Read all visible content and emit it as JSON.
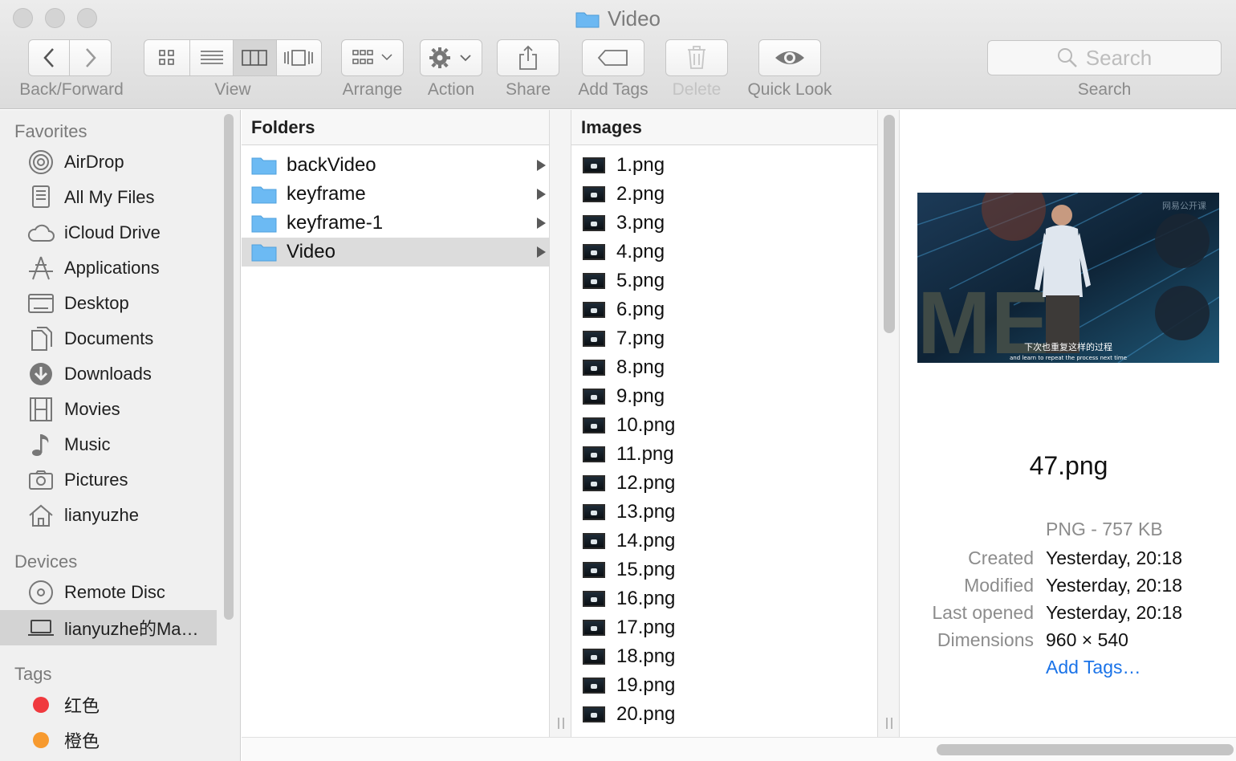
{
  "window": {
    "title": "Video"
  },
  "toolbar": {
    "back_forward_label": "Back/Forward",
    "view_label": "View",
    "arrange_label": "Arrange",
    "action_label": "Action",
    "share_label": "Share",
    "add_tags_label": "Add Tags",
    "delete_label": "Delete",
    "quick_look_label": "Quick Look",
    "search_placeholder": "Search",
    "search_label": "Search"
  },
  "sidebar": {
    "favorites_title": "Favorites",
    "favorites": [
      {
        "label": "AirDrop",
        "icon": "airdrop-icon"
      },
      {
        "label": "All My Files",
        "icon": "all-my-files-icon"
      },
      {
        "label": "iCloud Drive",
        "icon": "cloud-icon"
      },
      {
        "label": "Applications",
        "icon": "applications-icon"
      },
      {
        "label": "Desktop",
        "icon": "desktop-icon"
      },
      {
        "label": "Documents",
        "icon": "documents-icon"
      },
      {
        "label": "Downloads",
        "icon": "downloads-icon"
      },
      {
        "label": "Movies",
        "icon": "movies-icon"
      },
      {
        "label": "Music",
        "icon": "music-icon"
      },
      {
        "label": "Pictures",
        "icon": "pictures-icon"
      },
      {
        "label": "lianyuzhe",
        "icon": "home-icon"
      }
    ],
    "devices_title": "Devices",
    "devices": [
      {
        "label": "Remote Disc",
        "icon": "disc-icon"
      },
      {
        "label": "lianyuzhe的Ma…",
        "icon": "laptop-icon"
      }
    ],
    "tags_title": "Tags",
    "tags": [
      {
        "label": "红色",
        "color": "#f0393e"
      },
      {
        "label": "橙色",
        "color": "#f79a2f"
      }
    ]
  },
  "folders_column": {
    "header": "Folders",
    "items": [
      "backVideo",
      "keyframe",
      "keyframe-1",
      "Video"
    ]
  },
  "images_column": {
    "header": "Images",
    "items": [
      "1.png",
      "2.png",
      "3.png",
      "4.png",
      "5.png",
      "6.png",
      "7.png",
      "8.png",
      "9.png",
      "10.png",
      "11.png",
      "12.png",
      "13.png",
      "14.png",
      "15.png",
      "16.png",
      "17.png",
      "18.png",
      "19.png",
      "20.png"
    ]
  },
  "preview": {
    "subtitle_cn": "下次也重复这样的过程",
    "subtitle_en": "and learn to repeat the process next time",
    "watermark": "网易公开课",
    "stage_letters": "ME",
    "file_name": "47.png",
    "kind_size": "PNG - 757 KB",
    "created_key": "Created",
    "created_val": "Yesterday, 20:18",
    "modified_key": "Modified",
    "modified_val": "Yesterday, 20:18",
    "last_opened_key": "Last opened",
    "last_opened_val": "Yesterday, 20:18",
    "dimensions_key": "Dimensions",
    "dimensions_val": "960 × 540",
    "add_tags_link": "Add Tags…"
  }
}
